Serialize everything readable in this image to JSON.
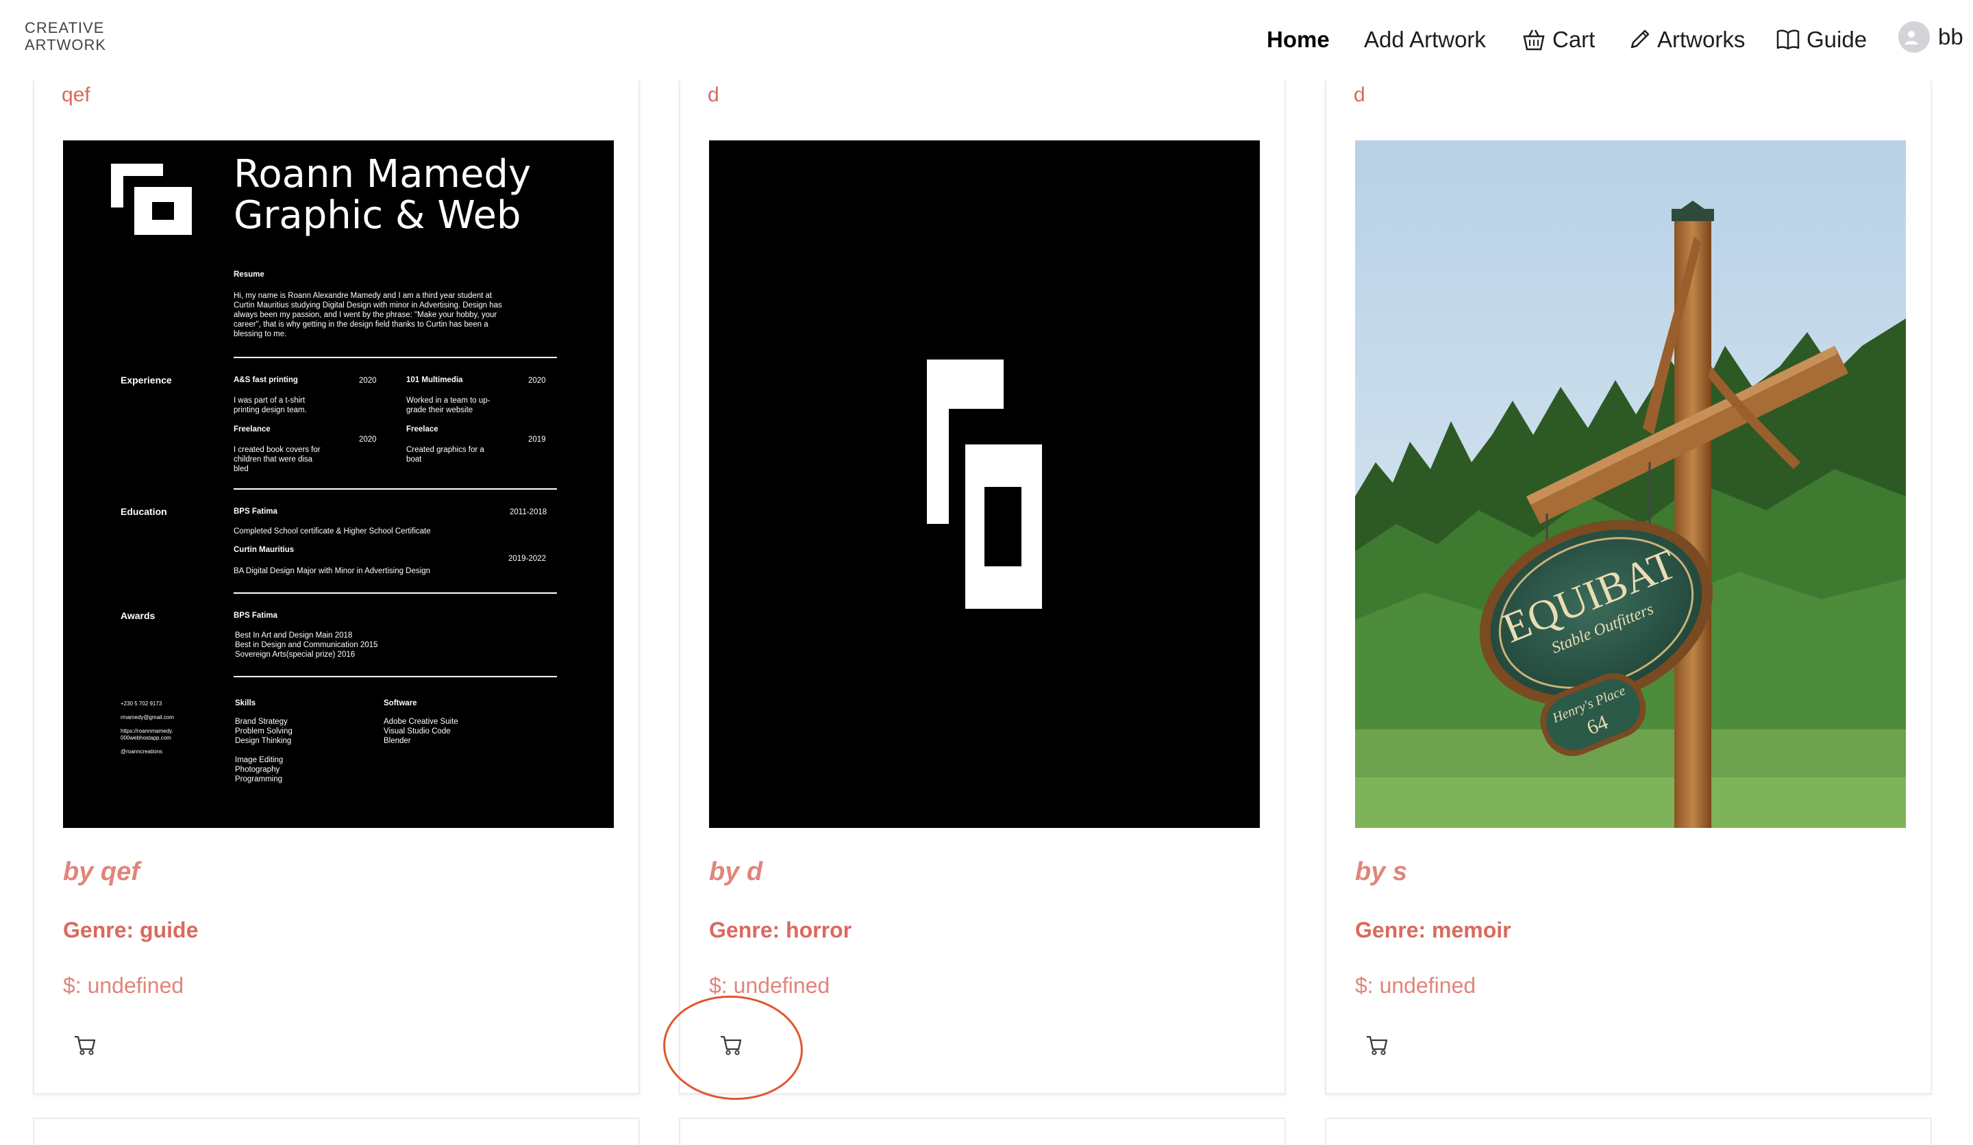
{
  "header": {
    "brand_line1": "CREATIVE",
    "brand_line2": "ARTWORK",
    "nav": {
      "home": "Home",
      "add_artwork": "Add Artwork",
      "cart": "Cart",
      "artworks": "Artworks",
      "guide": "Guide",
      "user": "bb"
    },
    "icons": {
      "cart": "basket-icon",
      "artworks": "pen-icon",
      "guide": "book-icon",
      "user": "user-avatar-icon"
    }
  },
  "cards": [
    {
      "title": "qef",
      "author": "by qef",
      "genre": "Genre: guide",
      "price": "$: undefined",
      "image": "resume-poster",
      "cart_icon": "cart-icon"
    },
    {
      "title": "d",
      "author": "by d",
      "genre": "Genre: horror",
      "price": "$: undefined",
      "image": "logo-mark",
      "cart_icon": "cart-icon",
      "highlighted": true
    },
    {
      "title": "d",
      "author": "by s",
      "genre": "Genre: memoir",
      "price": "$: undefined",
      "image": "equibat-sign-photo",
      "cart_icon": "cart-icon"
    }
  ],
  "resume": {
    "name_line1": "Roann Mamedy",
    "name_line2": "Graphic & Web",
    "resume_heading": "Resume",
    "resume_text": "Hi, my name is Roann Alexandre Mamedy and I am a third year student at\nCurtin Mauritius studying Digital Design with minor in Advertising. Design has\nalways been my passion, and I went by the phrase: \"Make your hobby, your\ncareer\", that is why getting in the design field thanks to Curtin has been a\nblessing to me.",
    "experience_label": "Experience",
    "exp1_title": "A&S fast printing",
    "exp1_year": "2020",
    "exp1_text": "I was part of a t-shirt\nprinting design team.",
    "exp2_title": "101 Multimedia",
    "exp2_year": "2020",
    "exp2_text": "Worked in a team to up-\ngrade their website",
    "exp3_title": "Freelance",
    "exp3_year": "2020",
    "exp3_text": "I created book covers for\nchildren that were disa\nbled",
    "exp4_title": "Freelace",
    "exp4_year": "2019",
    "exp4_text": "Created graphics for a\nboat",
    "education_label": "Education",
    "edu1_title": "BPS Fatima",
    "edu1_year": "2011-2018",
    "edu1_text": "Completed School certificate & Higher School Certificate",
    "edu2_title": "Curtin Mauritius",
    "edu2_year": "2019-2022",
    "edu2_text": "BA Digital Design Major with Minor in Advertising Design",
    "awards_label": "Awards",
    "award_title": "BPS Fatima",
    "award_text": "Best In Art and Design Main 2018\nBest in Design and Communication 2015\nSovereign Arts(special prize) 2016",
    "contact_text": "+230 5 702 9173\n\nrmamedy@gmail.com\n\nhttps://roannmamedy.\n000webhostapp.com\n\n@roanncreations",
    "skills_label": "Skills",
    "skills_text": "Brand Strategy\nProblem Solving\nDesign Thinking\n\nImage Editing\nPhotography\nProgramming",
    "software_label": "Software",
    "software_text": "Adobe Creative Suite\nVisual Studio Code\nBlender"
  },
  "sign": {
    "main": "EQUIBAT",
    "sub": "Stable Outfitters",
    "plate": "Henry's Place",
    "number": "64"
  },
  "colors": {
    "accent": "#d96a5e",
    "accent_light": "#e0857b",
    "highlight": "#e2552f"
  }
}
